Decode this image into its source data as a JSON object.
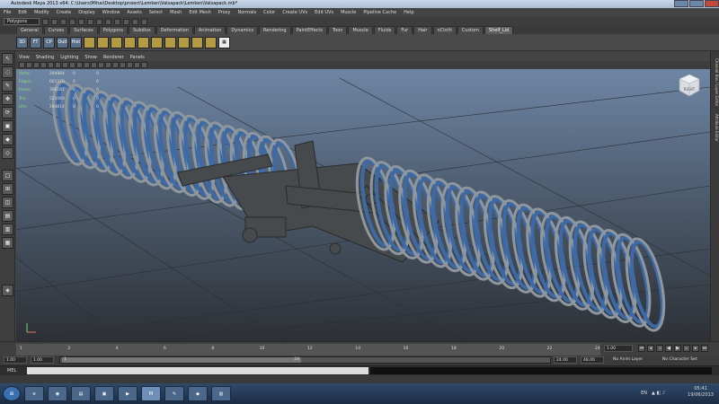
{
  "window": {
    "title": "Autodesk Maya 2013 x64: C:\\Users\\Mihai\\Desktop\\proiect\\Lemken\\Valsapack\\Lemken\\Valsapack.mb*"
  },
  "menubar": [
    "File",
    "Edit",
    "Modify",
    "Create",
    "Display",
    "Window",
    "Assets",
    "Select",
    "Mesh",
    "Edit Mesh",
    "Proxy",
    "Normals",
    "Color",
    "Create UVs",
    "Edit UVs",
    "Muscle",
    "Pipeline Cache",
    "Help"
  ],
  "status_line": {
    "mode": "Polygons"
  },
  "shelf": {
    "tabs": [
      "General",
      "Curves",
      "Surfaces",
      "Polygons",
      "Subdivs",
      "Deformation",
      "Animation",
      "Dynamics",
      "Rendering",
      "PaintEffects",
      "Toon",
      "Muscle",
      "Fluids",
      "Fur",
      "Hair",
      "nCloth",
      "Custom",
      "Shelf_Lid"
    ],
    "active_tab": "Shelf_Lid",
    "icon_labels": [
      "3D",
      "FT",
      "CP",
      "Outl",
      "Hist"
    ]
  },
  "panel_menu": [
    "View",
    "Shading",
    "Lighting",
    "Show",
    "Renderer",
    "Panels"
  ],
  "hud": {
    "rows": [
      {
        "label": "Verts:",
        "a": "294984",
        "b": "0",
        "c": "0"
      },
      {
        "label": "Edges:",
        "a": "601376",
        "b": "0",
        "c": "0"
      },
      {
        "label": "Faces:",
        "a": "308181",
        "b": "0",
        "c": "0"
      },
      {
        "label": "Tris:",
        "a": "521069",
        "b": "0",
        "c": "0"
      },
      {
        "label": "UVs:",
        "a": "294814",
        "b": "0",
        "c": "0"
      }
    ]
  },
  "viewcube": {
    "label": "RIGHT"
  },
  "right_panel": {
    "tab1": "Channel Box / Layer Editor",
    "tab2": "Attribute Editor"
  },
  "timeline": {
    "ticks": [
      "1",
      "2",
      "4",
      "6",
      "8",
      "10",
      "12",
      "14",
      "16",
      "18",
      "20",
      "22",
      "24"
    ],
    "current": "1.00"
  },
  "range": {
    "start": "1.00",
    "start_inner": "1.00",
    "thumb_start": "1",
    "thumb_end": "24",
    "end_inner": "24.00",
    "end": "48.00",
    "anim_layer": "No Anim Layer",
    "char_set": "No Character Set"
  },
  "cmd": {
    "label": "MEL"
  },
  "taskbar": {
    "lang": "EN",
    "time": "05:41",
    "date": "19/06/2013",
    "apps": [
      "start",
      "ie",
      "chrome",
      "explorer",
      "folder",
      "media",
      "maya",
      "paint",
      "app",
      "docs"
    ]
  },
  "colors": {
    "viewport_top": "#6e86a4",
    "viewport_bottom": "#2d3035",
    "ring": "#8e969e",
    "ring_inner": "#3d6aa6",
    "frame": "#474a4d"
  }
}
